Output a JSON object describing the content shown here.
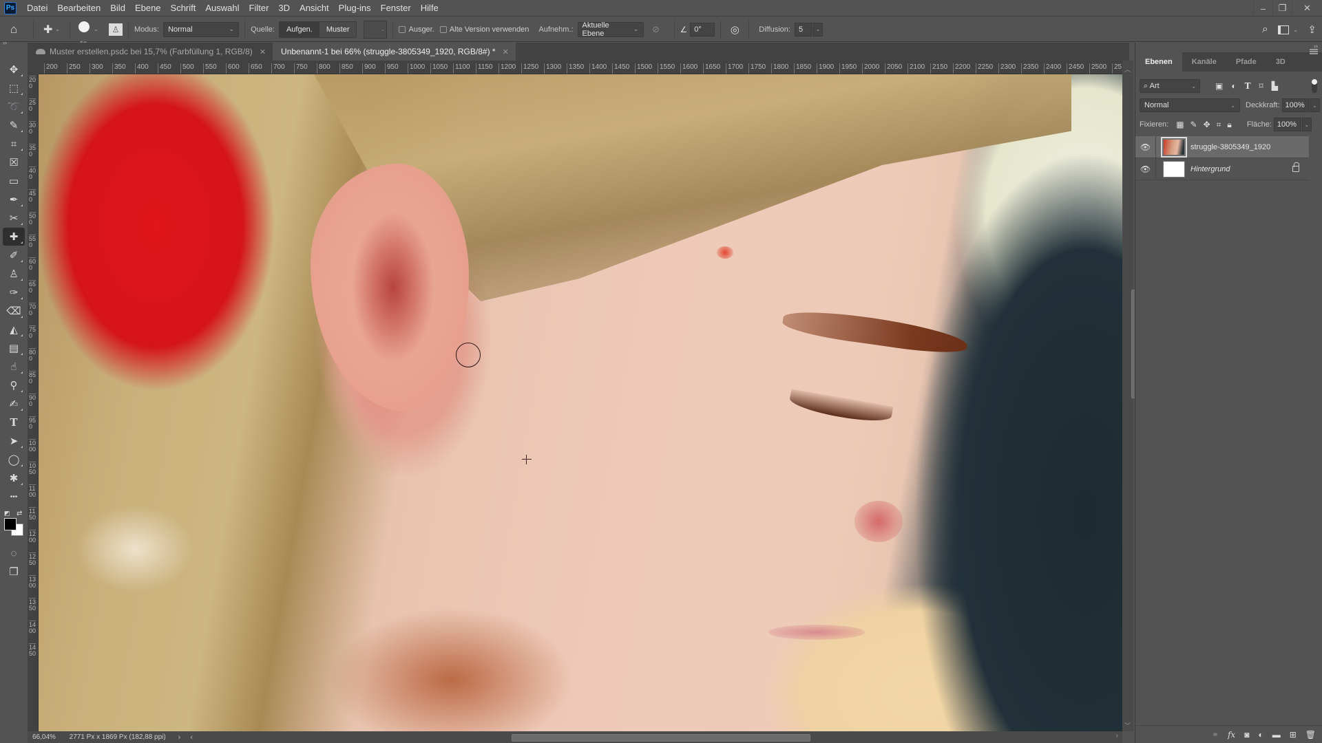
{
  "app": {
    "logo": "Ps",
    "menu": [
      "Datei",
      "Bearbeiten",
      "Bild",
      "Ebene",
      "Schrift",
      "Auswahl",
      "Filter",
      "3D",
      "Ansicht",
      "Plug-ins",
      "Fenster",
      "Hilfe"
    ],
    "window_controls": {
      "minimize": "–",
      "restore": "❐",
      "close": "✕"
    }
  },
  "options": {
    "brush_size": "52",
    "mode_label": "Modus:",
    "mode_value": "Normal",
    "source_label": "Quelle:",
    "source_options": [
      "Aufgen.",
      "Muster"
    ],
    "source_active": "Aufgen.",
    "aligned_label": "Ausger.",
    "legacy_label": "Alte Version verwenden",
    "sample_label": "Aufnehm.:",
    "sample_value": "Aktuelle Ebene",
    "angle_value": "0°",
    "diffusion_label": "Diffusion:",
    "diffusion_value": "5"
  },
  "tabs": [
    {
      "label": "Muster erstellen.psdc bei 15,7% (Farbfüllung 1, RGB/8)",
      "active": false,
      "cloud": true
    },
    {
      "label": "Unbenannt-1 bei 66% (struggle-3805349_1920, RGB/8#) *",
      "active": true,
      "cloud": false
    }
  ],
  "tools": [
    {
      "name": "move-tool",
      "glyph": "✥"
    },
    {
      "name": "marquee-tool",
      "glyph": "⬚"
    },
    {
      "name": "lasso-tool",
      "glyph": "➰"
    },
    {
      "name": "quick-selection-tool",
      "glyph": "✎"
    },
    {
      "name": "crop-tool",
      "glyph": "⌗"
    },
    {
      "name": "frame-tool",
      "glyph": "☒"
    },
    {
      "name": "ruler-tool",
      "glyph": "▭"
    },
    {
      "name": "eyedropper-tool",
      "glyph": "✒"
    },
    {
      "name": "content-aware-move-tool",
      "glyph": "✂"
    },
    {
      "name": "healing-brush-tool",
      "glyph": "✚",
      "active": true
    },
    {
      "name": "brush-tool",
      "glyph": "✐"
    },
    {
      "name": "clone-stamp-tool",
      "glyph": "♙"
    },
    {
      "name": "history-brush-tool",
      "glyph": "✑"
    },
    {
      "name": "eraser-tool",
      "glyph": "⌫"
    },
    {
      "name": "paint-bucket-tool",
      "glyph": "◭"
    },
    {
      "name": "gradient-tool",
      "glyph": "▤"
    },
    {
      "name": "smudge-tool",
      "glyph": "☝"
    },
    {
      "name": "dodge-tool",
      "glyph": "⚲"
    },
    {
      "name": "pen-tool",
      "glyph": "✍"
    },
    {
      "name": "type-tool",
      "glyph": "T"
    },
    {
      "name": "path-selection-tool",
      "glyph": "➤"
    },
    {
      "name": "ellipse-tool",
      "glyph": "◯"
    },
    {
      "name": "custom-shape-tool",
      "glyph": "✱"
    },
    {
      "name": "more-tools",
      "glyph": "•••"
    }
  ],
  "extra_tools": [
    {
      "name": "quick-mask-button",
      "glyph": "◌"
    },
    {
      "name": "screen-mode-button",
      "glyph": "❐"
    }
  ],
  "colors": {
    "foreground": "#000000",
    "background": "#ffffff"
  },
  "ruler": {
    "h_labels": [
      "200",
      "250",
      "300",
      "350",
      "400",
      "450",
      "500",
      "550",
      "600",
      "650",
      "700",
      "750",
      "800",
      "850",
      "900",
      "950",
      "1000",
      "1050",
      "1100",
      "1150",
      "1200",
      "1250",
      "1300",
      "1350",
      "1400",
      "1450",
      "1500",
      "1550",
      "1600",
      "1650",
      "1700",
      "1750",
      "1800",
      "1850",
      "1900",
      "1950",
      "2000",
      "2050",
      "2100",
      "2150",
      "2200",
      "2250",
      "2300",
      "2350",
      "2400",
      "2450",
      "2500",
      "25"
    ],
    "v_labels": [
      "200",
      "250",
      "300",
      "350",
      "400",
      "450",
      "500",
      "550",
      "600",
      "650",
      "700",
      "750",
      "800",
      "850",
      "900",
      "950",
      "1000",
      "1050",
      "1100",
      "1150",
      "1200",
      "1250",
      "1300",
      "1350",
      "1400",
      "1450"
    ]
  },
  "status": {
    "zoom": "66,04%",
    "doc_info": "2771 Px x 1869 Px (182,88 ppi)"
  },
  "panel": {
    "tabs": [
      "Ebenen",
      "Kanäle",
      "Pfade",
      "3D"
    ],
    "active_tab": "Ebenen",
    "filter_value": "Art",
    "blend_mode": "Normal",
    "opacity_label": "Deckkraft:",
    "opacity_value": "100%",
    "lock_label": "Fixieren:",
    "fill_label": "Fläche:",
    "fill_value": "100%",
    "layers": [
      {
        "name": "struggle-3805349_1920",
        "visible": true,
        "selected": true,
        "locked": false,
        "italic": false
      },
      {
        "name": "Hintergrund",
        "visible": true,
        "selected": false,
        "locked": true,
        "italic": true
      }
    ]
  }
}
